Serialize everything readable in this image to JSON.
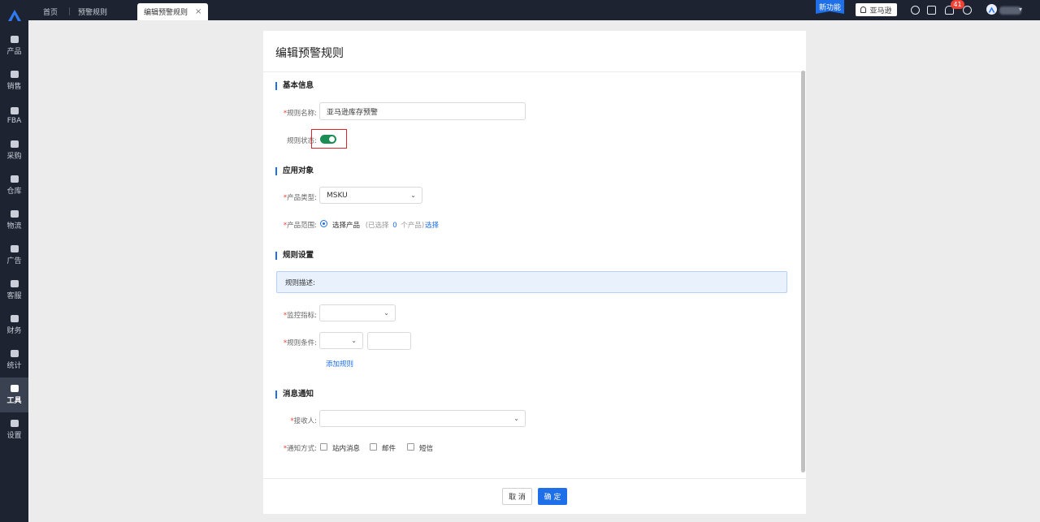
{
  "sidebar": {
    "logo": "A",
    "items": [
      {
        "label": "产品",
        "icon": "box-icon"
      },
      {
        "label": "销售",
        "icon": "shop-icon"
      },
      {
        "label": "FBA",
        "icon": "warehouse-icon"
      },
      {
        "label": "采购",
        "icon": "cart-icon"
      },
      {
        "label": "仓库",
        "icon": "storage-icon"
      },
      {
        "label": "物流",
        "icon": "truck-icon"
      },
      {
        "label": "广告",
        "icon": "ad-icon"
      },
      {
        "label": "客服",
        "icon": "mail-icon"
      },
      {
        "label": "财务",
        "icon": "money-icon"
      },
      {
        "label": "统计",
        "icon": "pie-icon"
      },
      {
        "label": "工具",
        "icon": "wrench-icon"
      },
      {
        "label": "设置",
        "icon": "gear-icon"
      }
    ]
  },
  "tabs": [
    {
      "label": "首页"
    },
    {
      "label": "预警规则"
    },
    {
      "label": "编辑预警规则",
      "close": "×"
    }
  ],
  "header": {
    "new_feature": "新功能",
    "shop_label": "亚马逊",
    "notification_count": "41"
  },
  "page": {
    "title": "编辑预警规则",
    "sections": {
      "basic": "基本信息",
      "target": "应用对象",
      "rule": "规则设置",
      "notify": "消息通知"
    },
    "fields": {
      "rule_name_label": "规则名称:",
      "rule_name_value": "亚马逊库存预警",
      "rule_status_label": "规则状态:",
      "product_type_label": "产品类型:",
      "product_type_value": "MSKU",
      "product_scope_label": "产品范围:",
      "scope_option": "选择产品",
      "scope_prefix": "(已选择",
      "scope_count": "0",
      "scope_suffix": "个产品)",
      "scope_select_link": "选择",
      "rule_desc": "规则描述:",
      "monitor_label": "监控指标:",
      "condition_label": "规则条件:",
      "add_rule_link": "添加规则",
      "receiver_label": "接收人:",
      "notify_method_label": "通知方式:",
      "notify_options": [
        "站内消息",
        "邮件",
        "短信"
      ]
    },
    "buttons": {
      "cancel": "取 消",
      "ok": "确 定"
    }
  }
}
